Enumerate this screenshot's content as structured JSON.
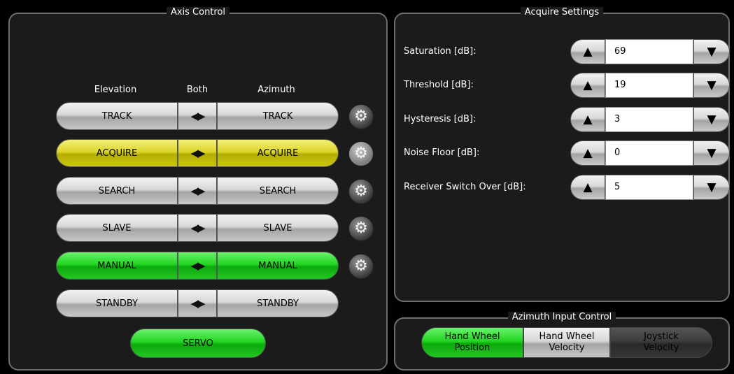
{
  "axis_control": {
    "title": "Axis Control",
    "headers": {
      "elevation": "Elevation",
      "both": "Both",
      "azimuth": "Azimuth"
    },
    "modes": [
      {
        "elevation": "TRACK",
        "azimuth": "TRACK",
        "state": "gray"
      },
      {
        "elevation": "ACQUIRE",
        "azimuth": "ACQUIRE",
        "state": "yellow"
      },
      {
        "elevation": "SEARCH",
        "azimuth": "SEARCH",
        "state": "gray"
      },
      {
        "elevation": "SLAVE",
        "azimuth": "SLAVE",
        "state": "gray"
      },
      {
        "elevation": "MANUAL",
        "azimuth": "MANUAL",
        "state": "green"
      },
      {
        "elevation": "STANDBY",
        "azimuth": "STANDBY",
        "state": "gray"
      }
    ],
    "both_icon": "double-arrow-icon",
    "settings_icon": "gear-icon",
    "servo_label": "SERVO"
  },
  "acquire_settings": {
    "title": "Acquire Settings",
    "fields": [
      {
        "label": "Saturation [dB]:",
        "value": "69"
      },
      {
        "label": "Threshold [dB]:",
        "value": "19"
      },
      {
        "label": "Hysteresis [dB]:",
        "value": "3"
      },
      {
        "label": "Noise Floor [dB]:",
        "value": "0"
      },
      {
        "label": "Receiver Switch Over [dB]:",
        "value": "5"
      }
    ]
  },
  "azimuth_input_control": {
    "title": "Azimuth Input Control",
    "options": [
      {
        "line1": "Hand Wheel",
        "line2": "Position",
        "state": "green"
      },
      {
        "line1": "Hand Wheel",
        "line2": "Velocity",
        "state": "gray"
      },
      {
        "line1": "Joystick",
        "line2": "Velocity",
        "state": "dark"
      }
    ]
  },
  "colors": {
    "active_yellow": "#dcd52b",
    "active_green": "#22d522",
    "inactive_gray": "#d8d8d8",
    "disabled_dark": "#3d3d3d"
  }
}
